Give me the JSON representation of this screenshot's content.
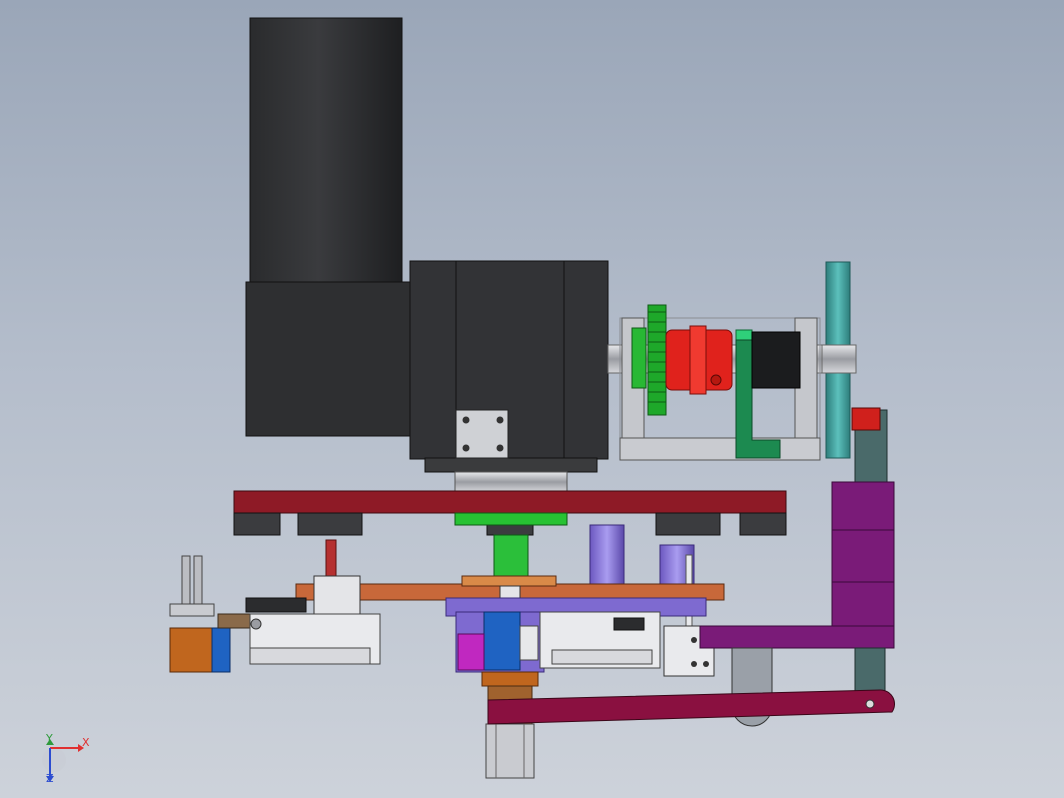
{
  "viewport": {
    "background_top": "#9aa6b8",
    "background_bottom": "#cdd2da"
  },
  "triad": {
    "x_label": "X",
    "y_label": "Y",
    "z_label": "Z",
    "x_color": "#e03030",
    "y_color": "#2e9a3c",
    "z_color": "#2c4cd0"
  },
  "colors": {
    "motor": "#2b2c2e",
    "plate_red": "#8e1a26",
    "plate_orange": "#c8683a",
    "gear_green": "#1ea82a",
    "coupling_red": "#e0221c",
    "flywheel_teal": "#3f9a98",
    "arm_purple": "#7a1b78",
    "link_maroon": "#8a1040",
    "frame_gray": "#b9bcc2",
    "cylinder_lavender": "#7e6ad0"
  }
}
